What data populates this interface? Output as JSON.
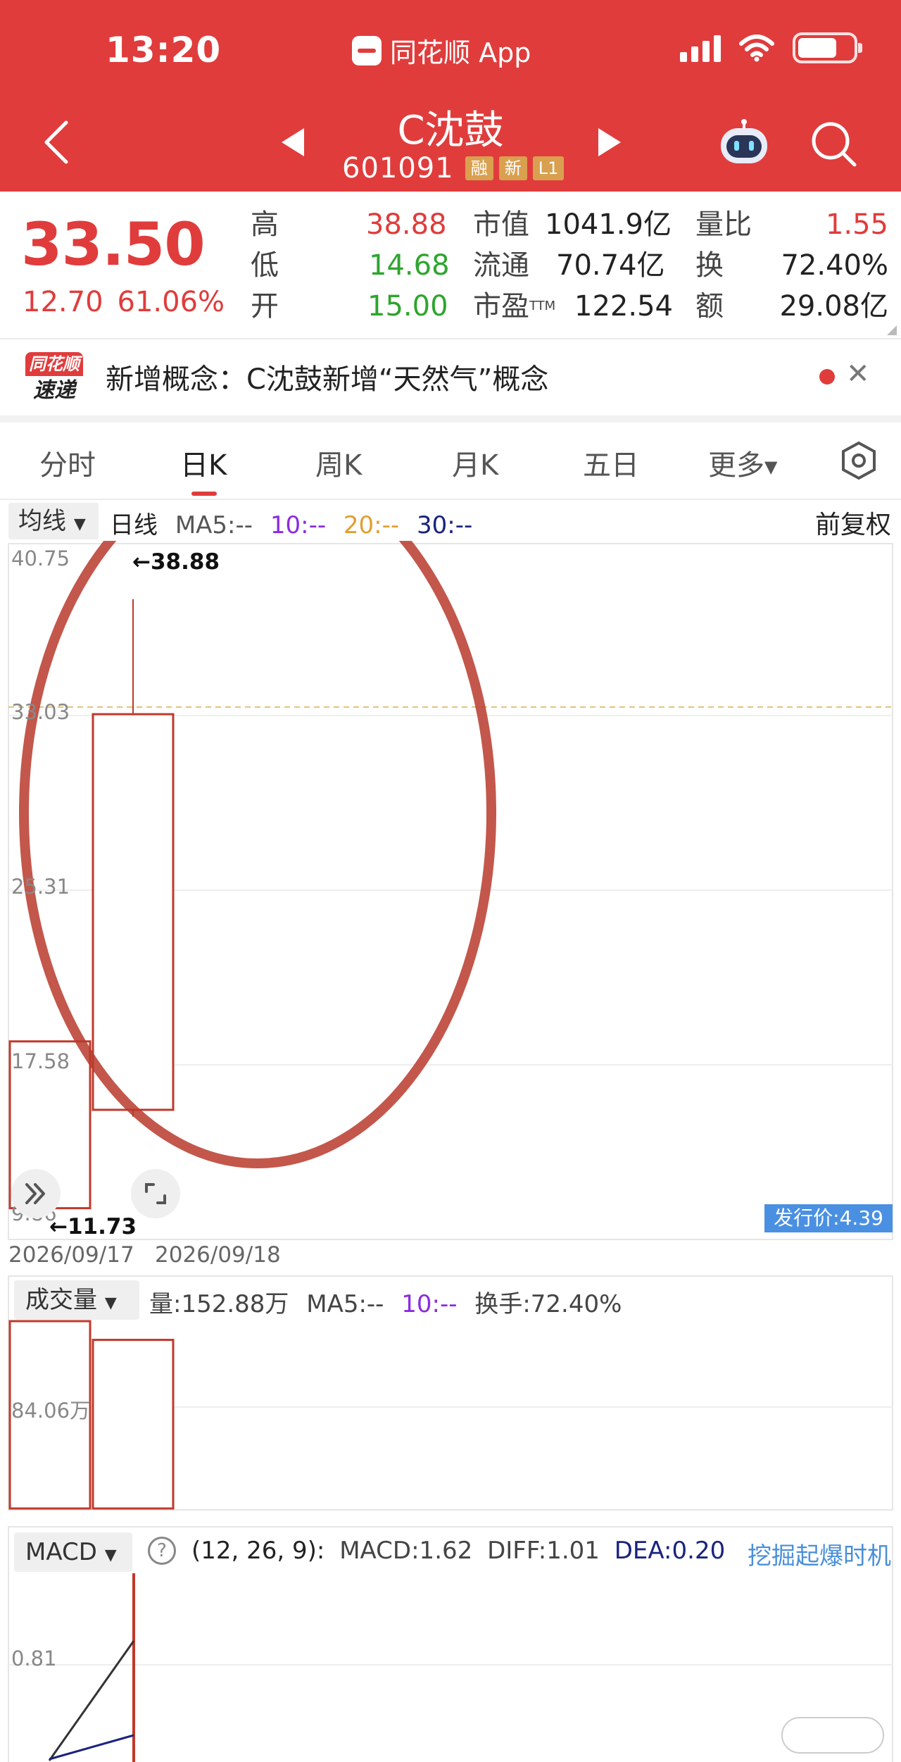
{
  "status_bar": {
    "time": "13:20",
    "app_name": "同花顺 App"
  },
  "header": {
    "stock_name": "C沈鼓",
    "stock_code": "601091",
    "tags": [
      "融",
      "新",
      "L1"
    ]
  },
  "quote": {
    "price": "33.50",
    "change": "12.70",
    "change_pct": "61.06%",
    "high_label": "高",
    "high": "38.88",
    "low_label": "低",
    "low": "14.68",
    "open_label": "开",
    "open": "15.00",
    "mktcap_label": "市值",
    "mktcap": "1041.9亿",
    "float_label": "流通",
    "float": "70.74亿",
    "pe_label": "市盈",
    "pe_sup": "TTM",
    "pe": "122.54",
    "volratio_label": "量比",
    "volratio": "1.55",
    "turnover_label": "换",
    "turnover": "72.40%",
    "amount_label": "额",
    "amount": "29.08亿"
  },
  "news": {
    "logo_top": "同花顺",
    "logo_bottom": "速递",
    "text": "新增概念：C沈鼓新增“天然气”概念"
  },
  "tabs": [
    {
      "label": "分时"
    },
    {
      "label": "日K"
    },
    {
      "label": "周K"
    },
    {
      "label": "月K"
    },
    {
      "label": "五日"
    }
  ],
  "tab_more": "更多",
  "chart_toolbar": {
    "ma_button": "均线",
    "period": "日线",
    "ma5": "MA5:--",
    "ma10": "10:--",
    "ma20": "20:--",
    "ma30": "30:--",
    "adjust": "前复权"
  },
  "price_axis": [
    "40.75",
    "33.03",
    "25.31",
    "17.58",
    "9.86"
  ],
  "high_marker": "←38.88",
  "low_marker": "←11.73",
  "issue_price": "发行价:4.39",
  "dates": [
    "2026/09/17",
    "2026/09/18"
  ],
  "volume": {
    "button": "成交量",
    "vol": "量:152.88万",
    "ma5": "MA5:--",
    "ma10": "10:--",
    "turnover": "换手:72.40%",
    "axis_label": "84.06万"
  },
  "macd": {
    "button": "MACD",
    "params": "(12, 26, 9):",
    "macd": "MACD:1.62",
    "diff": "DIFF:1.01",
    "dea": "DEA:0.20",
    "link": "挖掘起爆时机",
    "axis_label": "0.81"
  },
  "chart_data": {
    "type": "candlestick",
    "ylim": [
      9.86,
      40.75
    ],
    "candles": [
      {
        "date": "2026/09/17",
        "open": 18.2,
        "close": 10.4,
        "high": 18.2,
        "low": 10.4
      },
      {
        "date": "2026/09/18",
        "open": 15.0,
        "close": 33.5,
        "high": 38.88,
        "low": 14.68
      }
    ],
    "volume": [
      1.0,
      0.9
    ],
    "colors": {
      "up": "#c0392b",
      "ma10": "#8a2be2",
      "ma20": "#e0a030",
      "ma30": "#1a237e",
      "accent": "#e03c3c",
      "down_green": "#2ea52e"
    }
  }
}
